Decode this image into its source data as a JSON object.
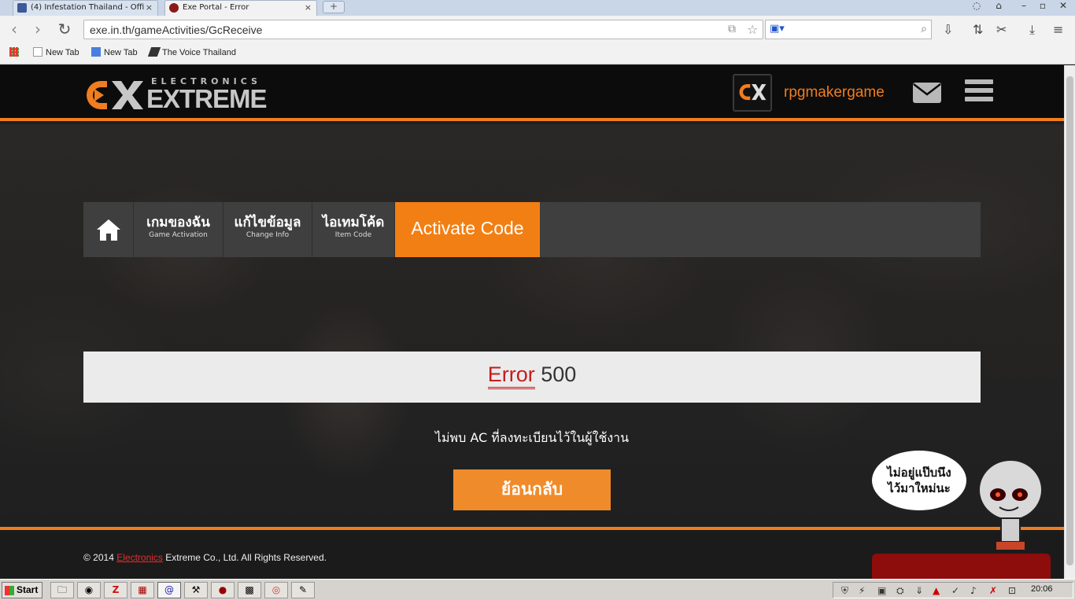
{
  "browser": {
    "tabs": [
      {
        "title": "(4) Infestation Thailand - Offi",
        "close": "×"
      },
      {
        "title": "Exe Portal - Error",
        "close": "×"
      }
    ],
    "new_tab_symbol": "+",
    "nav": {
      "back": "‹",
      "forward": "›",
      "reload": "↻"
    },
    "url": "exe.in.th/gameActivities/GcReceive",
    "bookmarks": [
      "New Tab",
      "New Tab",
      "The Voice Thailand"
    ]
  },
  "site": {
    "logo_top": "ELECTRONICS",
    "logo_main": "EXTREME",
    "username": "rpgmakergame",
    "nav": {
      "game_activation_th": "เกมของฉัน",
      "game_activation_en": "Game Activation",
      "change_info_th": "แก้ไขข้อมูล",
      "change_info_en": "Change Info",
      "item_code_th": "ไอเทมโค้ด",
      "item_code_en": "Item Code",
      "activate_code": "Activate Code"
    },
    "error": {
      "word": "Error",
      "code": "500"
    },
    "message": "ไม่พบ AC ที่ลงทะเบียนไว้ในผู้ใช้งาน",
    "back_button": "ย้อนกลับ",
    "footer": {
      "prefix": "© 2014 ",
      "link": "Electronics",
      "suffix": " Extreme Co., Ltd. All Rights Reserved."
    },
    "mascot": {
      "line1": "ไม่อยู่แป๊บนึง",
      "line2": "ไว้มาใหม่นะ"
    }
  },
  "taskbar": {
    "start": "Start",
    "clock": "20:06"
  },
  "colors": {
    "accent": "#f07d1f",
    "error_red": "#c51d1d",
    "header_bg": "#0c0c0c"
  }
}
